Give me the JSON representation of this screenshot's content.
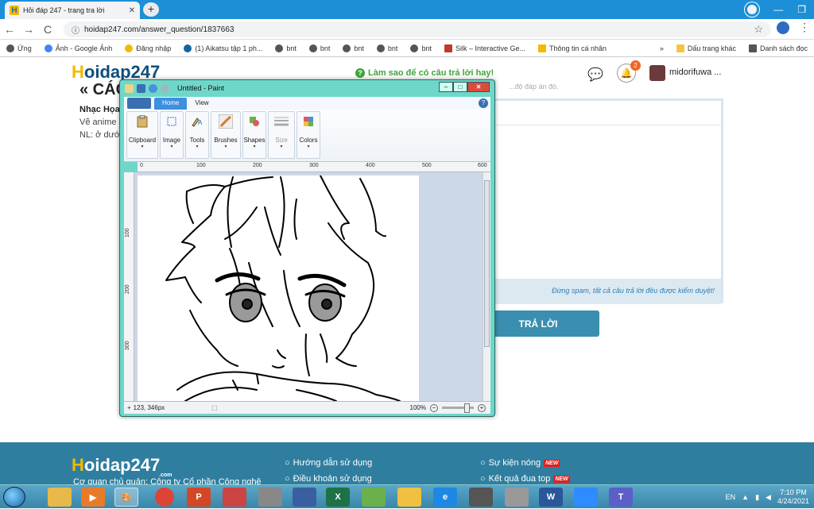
{
  "browser": {
    "tab_title": "Hỏi đáp 247 - trang tra lời",
    "tab_close": "✕",
    "new_tab": "+",
    "url": "hoidap247.com/answer_question/1837663",
    "nav_back": "←",
    "nav_forward": "→",
    "nav_reload": "C",
    "url_lock": "ⓘ",
    "star": "☆",
    "kebab": "⋮",
    "win_min": "—",
    "win_max": "❐",
    "bookmarks": [
      "Ảnh - Google Ảnh",
      "Đăng nhập",
      "(1) Aikatsu tập 1 ph...",
      "bnt",
      "bnt",
      "bnt",
      "bnt",
      "bnt",
      "Silk – Interactive Ge...",
      "Thông tin cá nhân"
    ],
    "apps_label": "Ứng",
    "bookmarks_more": "»",
    "other_bookmarks": "Dấu trang khác",
    "reading_list": "Danh sách đọc"
  },
  "site": {
    "logo_h": "H",
    "logo_text": "oidap247",
    "logo_com": ".com",
    "hint": "Làm sao để có câu trả lời hay!",
    "hint_icon": "?",
    "notif_count": "2",
    "username": "midorifuwa ...",
    "question_title": "« CÁC",
    "question_author": "Nhạc Họa",
    "question_line1": "Vẽ anime",
    "question_line2": "NL: ở dướ",
    "hidden_text": "...độ đáp án đó.",
    "spam_note": "Đừng spam, tất cả câu trả lời đều được kiểm duyệt!",
    "answer_button": "TRẢ LỜI",
    "footer_company": "Cơ quan chủ quản: Công ty Cổ phần Công nghệ",
    "footer_links": [
      {
        "label": "Hướng dẫn sử dụng",
        "new": false
      },
      {
        "label": "Điều khoản sử dụng",
        "new": false
      },
      {
        "label": "Sự kiện nóng",
        "new": true
      },
      {
        "label": "Kết quả đua top",
        "new": true
      }
    ],
    "new_badge": "NEW"
  },
  "paint": {
    "title": "Untitled - Paint",
    "tabs": [
      "Home",
      "View"
    ],
    "help": "?",
    "groups": [
      {
        "label": "Clipboard",
        "icon": "clipboard-icon",
        "dim": false
      },
      {
        "label": "Image",
        "icon": "select-icon",
        "dim": false
      },
      {
        "label": "Tools",
        "icon": "tools-icon",
        "dim": false
      },
      {
        "label": "Brushes",
        "icon": "brush-icon",
        "dim": false
      },
      {
        "label": "Shapes",
        "icon": "shapes-icon",
        "dim": false
      },
      {
        "label": "Size",
        "icon": "size-icon",
        "dim": true
      },
      {
        "label": "Colors",
        "icon": "colors-icon",
        "dim": false
      }
    ],
    "ruler_h": [
      "0",
      "100",
      "200",
      "300",
      "400",
      "500",
      "600"
    ],
    "ruler_v": [
      "100",
      "200",
      "300"
    ],
    "cursor_pos": "123, 346px",
    "zoom": "100%"
  },
  "taskbar": {
    "lang": "EN",
    "time": "7:10 PM",
    "date": "4/24/2021"
  },
  "colors": {
    "browser_blue": "#1d8fd6",
    "site_navy": "#0e4f7e",
    "logo_yellow": "#f5b800",
    "answer_button": "#3a8fb0",
    "footer": "#2f7ea0",
    "paint_frame": "#6fd7c9"
  }
}
